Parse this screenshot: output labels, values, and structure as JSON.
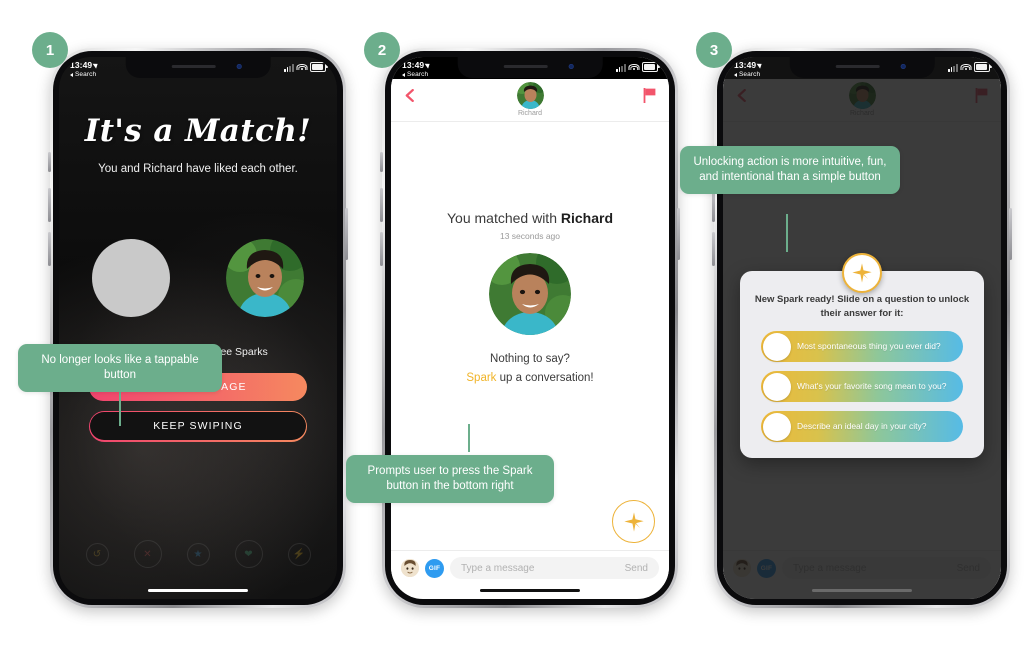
{
  "meta": {
    "accent_green": "#6cae8c",
    "accent_gold": "#edb33a",
    "accent_pink": "#f0446e",
    "accent_orange": "#f5895f"
  },
  "status_bar": {
    "time": "13:49",
    "back_label": "Search",
    "location_icon": "location-arrow-icon",
    "signal_icon": "cellular-signal-icon",
    "wifi_icon": "wifi-icon",
    "battery_icon": "battery-icon"
  },
  "phones": [
    {
      "badge": "1",
      "screen": "its-a-match",
      "match": {
        "title": "It's a Match!",
        "subtitle": "You and Richard have liked each other.",
        "left_avatar": "placeholder-avatar",
        "right_avatar": "richard-avatar",
        "spark_icon": "spark-starburst-icon",
        "spark_note": "Richard has three Sparks",
        "primary_button": "SEND MESSAGE",
        "secondary_button": "KEEP SWIPING",
        "swipe_actions": [
          "rewind-icon",
          "nope-icon",
          "superlike-icon",
          "like-icon",
          "boost-icon"
        ]
      }
    },
    {
      "badge": "2",
      "screen": "chat-empty",
      "nav": {
        "back_icon": "chevron-left-icon",
        "flag_icon": "report-flag-icon",
        "avatar": "richard-avatar",
        "name": "Richard"
      },
      "body": {
        "matched_prefix": "You matched with ",
        "matched_name": "Richard",
        "timestamp": "13 seconds ago",
        "avatar": "richard-avatar",
        "empty_line1": "Nothing to say?",
        "empty_spark_word": "Spark",
        "empty_line2_rest": " up a conversation!",
        "spark_button_icon": "spark-starburst-icon"
      },
      "input": {
        "memoji_icon": "memoji-avatar-icon",
        "gif_label": "GIF",
        "placeholder": "Type a message",
        "send_label": "Send"
      }
    },
    {
      "badge": "3",
      "screen": "spark-modal",
      "nav": {
        "back_icon": "chevron-left-icon",
        "flag_icon": "report-flag-icon",
        "avatar": "richard-avatar",
        "name": "Richard"
      },
      "spark_card": {
        "spark_icon": "spark-starburst-icon",
        "title": "New Spark ready! Slide on a question to unlock their answer for it:",
        "questions": [
          "Most spontaneous thing you ever did?",
          "What's your favorite song mean to you?",
          "Describe an ideal day in your city?"
        ]
      },
      "input": {
        "memoji_icon": "memoji-avatar-icon",
        "gif_label": "GIF",
        "placeholder": "Type a message",
        "send_label": "Send"
      }
    }
  ],
  "callouts": [
    {
      "text": "No longer looks like a tappable button"
    },
    {
      "text": "Prompts user to press the Spark button in the bottom right"
    },
    {
      "text": "Unlocking action is more intuitive, fun, and intentional than a simple button"
    }
  ]
}
